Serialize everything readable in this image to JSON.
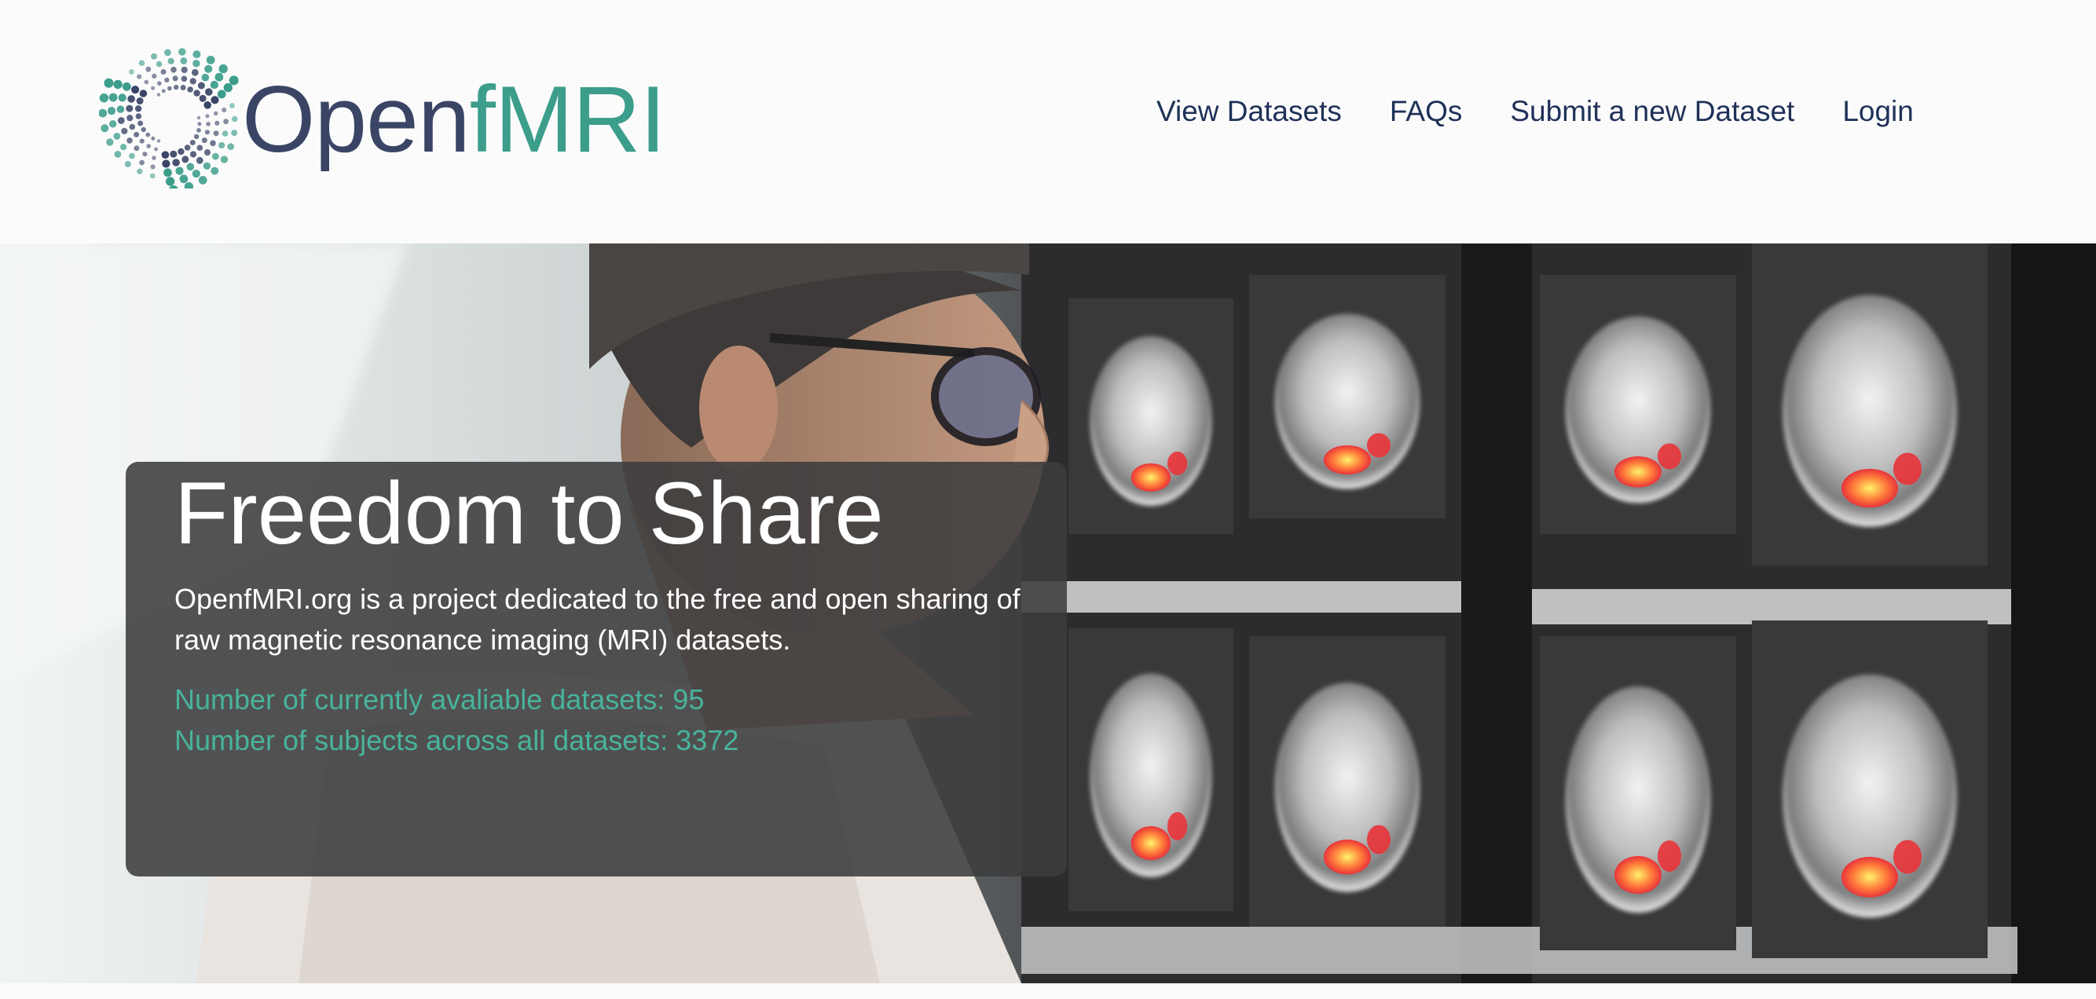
{
  "logo": {
    "text_open": "Open",
    "text_fmri": "fMRI",
    "colors": {
      "open": "#3a4566",
      "fmri": "#3c9d8b"
    }
  },
  "nav": {
    "items": [
      {
        "label": "View Datasets"
      },
      {
        "label": "FAQs"
      },
      {
        "label": "Submit a new Dataset"
      },
      {
        "label": "Login"
      }
    ],
    "color": "#1f3158"
  },
  "hero": {
    "title": "Freedom to Share",
    "description": "OpenfMRI.org is a project dedicated to the free and open sharing of raw magnetic resonance imaging (MRI) datasets.",
    "stats": {
      "datasets_line": "Number of currently avaliable datasets: 95",
      "subjects_line": "Number of subjects across all datasets: 3372",
      "color": "#48b39c"
    },
    "background_image": "photo of a man wearing glasses looking at a wall of brain MRI scans with red and yellow activation highlights"
  }
}
